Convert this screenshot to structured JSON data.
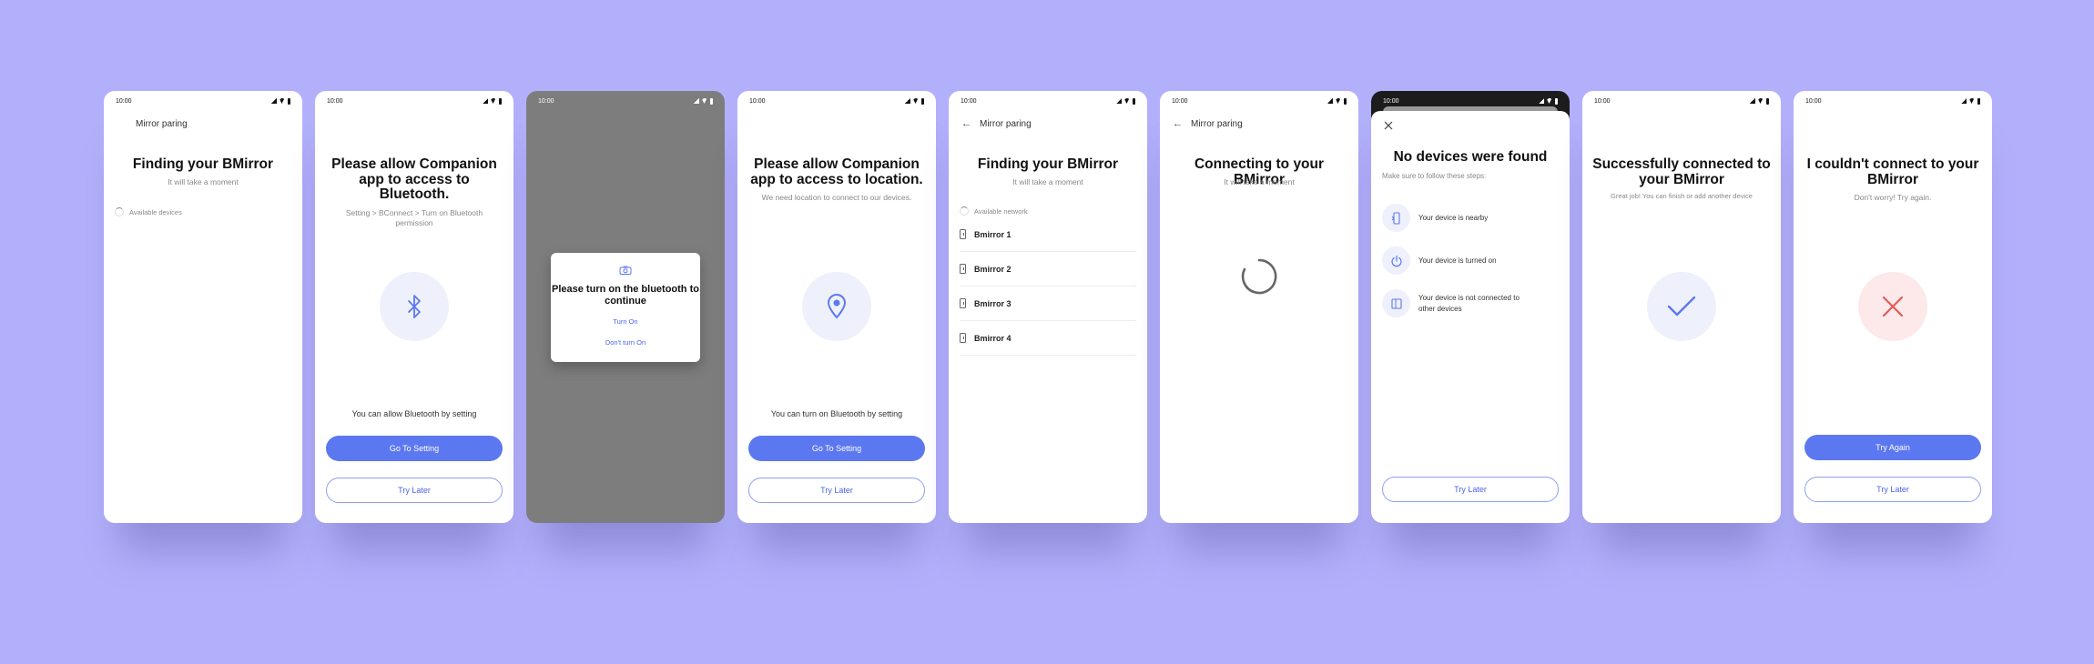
{
  "screens": [
    {
      "status_time": "10:00",
      "header_title": "Mirror paring",
      "title": "Finding your BMirror",
      "subtitle": "It will take a moment",
      "available_label": "Available devices"
    },
    {
      "status_time": "10:00",
      "title": "Please allow Companion app to access to Bluetooth.",
      "subtitle": "Setting > BConnect > Turn on Bluetooth permission",
      "hint": "You can allow Bluetooth by setting",
      "primary_button": "Go To Setting",
      "secondary_button": "Try Later"
    },
    {
      "status_time": "10:00",
      "dialog_title": "Please turn on the bluetooth to continue",
      "dialog_confirm": "Turn On",
      "dialog_cancel": "Don't turn On"
    },
    {
      "status_time": "10:00",
      "title": "Please allow Companion app to access to location.",
      "subtitle": "We need location to connect to our devices.",
      "hint": "You can turn on Bluetooth by setting",
      "primary_button": "Go To Setting",
      "secondary_button": "Try Later"
    },
    {
      "status_time": "10:00",
      "header_title": "Mirror paring",
      "title": "Finding your BMirror",
      "subtitle": "It will take a moment",
      "available_label": "Available network",
      "devices": [
        "Bmirror 1",
        "Bmirror 2",
        "Bmirror 3",
        "Bmirror 4"
      ]
    },
    {
      "status_time": "10:00",
      "header_title": "Mirror paring",
      "title": "Connecting to your BMirror",
      "subtitle": "It will take a moment"
    },
    {
      "status_time": "10:00",
      "title": "No devices were found",
      "subtitle": "Make sure to follow these steps:",
      "steps": [
        "Your device is nearby",
        "Your device is turned on",
        "Your device is not connected to other devices"
      ],
      "secondary_button": "Try Later"
    },
    {
      "status_time": "10:00",
      "title": "Successfully connected to your BMirror",
      "subtitle": "Great job! You can finish or add another device"
    },
    {
      "status_time": "10:00",
      "title": "I couldn't connect to your BMirror",
      "subtitle": "Don't worry! Try again.",
      "primary_button": "Try Again",
      "secondary_button": "Try Later"
    }
  ],
  "colors": {
    "background": "#b3b0fb",
    "accent": "#5c78f0",
    "icon_circle": "#eef1fb",
    "error_circle": "#fde9e9",
    "error": "#e25b5b",
    "overlay": "#7d7d7d"
  },
  "icons": [
    "bluetooth-icon",
    "location-pin-icon",
    "camera-icon",
    "spinner-icon",
    "check-icon",
    "close-x-icon",
    "back-arrow-icon",
    "phone-device-icon",
    "power-icon",
    "mirror-device-icon"
  ]
}
